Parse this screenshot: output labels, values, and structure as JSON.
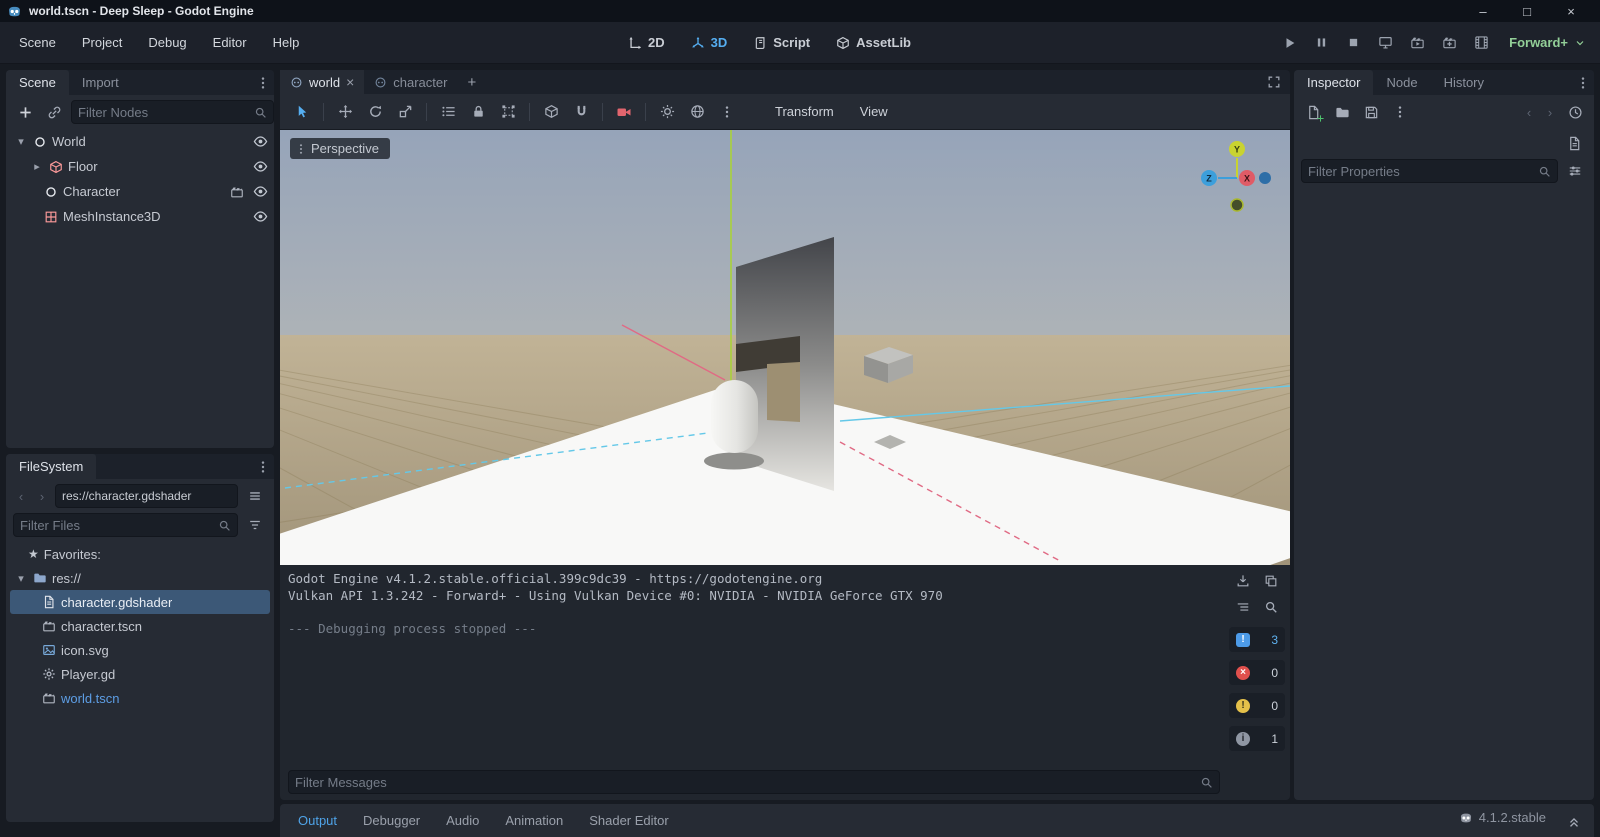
{
  "window": {
    "title": "world.tscn - Deep Sleep - Godot Engine"
  },
  "glyphs": {
    "minimize": "–",
    "maximize": "□",
    "close": "×",
    "plus": "+",
    "star": "★",
    "caret_down": "▾",
    "caret_right": "▸",
    "chevron_left": "‹",
    "chevron_right": "›",
    "log_badge": "!",
    "error_badge": "×",
    "warning_badge": "!",
    "info_badge": "i"
  },
  "menubar": {
    "menus": [
      {
        "label": "Scene"
      },
      {
        "label": "Project"
      },
      {
        "label": "Debug"
      },
      {
        "label": "Editor"
      },
      {
        "label": "Help"
      }
    ],
    "context": [
      {
        "label": "2D"
      },
      {
        "label": "3D"
      },
      {
        "label": "Script"
      },
      {
        "label": "AssetLib"
      }
    ],
    "renderer": "Forward+"
  },
  "scene_dock": {
    "tabs": [
      {
        "label": "Scene"
      },
      {
        "label": "Import"
      }
    ],
    "filter_placeholder": "Filter Nodes",
    "nodes": [
      {
        "name": "World"
      },
      {
        "name": "Floor"
      },
      {
        "name": "Character"
      },
      {
        "name": "MeshInstance3D"
      }
    ]
  },
  "filesystem_dock": {
    "title": "FileSystem",
    "path": "res://character.gdshader",
    "filter_placeholder": "Filter Files",
    "items": [
      {
        "name": "Favorites:"
      },
      {
        "name": "res://"
      },
      {
        "name": "character.gdshader"
      },
      {
        "name": "character.tscn"
      },
      {
        "name": "icon.svg"
      },
      {
        "name": "Player.gd"
      },
      {
        "name": "world.tscn"
      }
    ]
  },
  "scene_tabs": {
    "tabs": [
      {
        "label": "world"
      },
      {
        "label": "character"
      }
    ]
  },
  "viewport": {
    "projection_label": "Perspective",
    "menus": [
      {
        "label": "Transform"
      },
      {
        "label": "View"
      }
    ],
    "gizmo": {
      "x": "X",
      "y": "Y",
      "z": "Z"
    }
  },
  "output": {
    "lines": [
      "Godot Engine v4.1.2.stable.official.399c9dc39 - https://godotengine.org",
      "Vulkan API 1.3.242 - Forward+ - Using Vulkan Device #0: NVIDIA - NVIDIA GeForce GTX 970",
      "",
      "--- Debugging process stopped ---"
    ],
    "filter_placeholder": "Filter Messages",
    "counts": {
      "log": "3",
      "errors": "0",
      "warnings": "0",
      "info": "1"
    }
  },
  "bottom_bar": {
    "tabs": [
      {
        "label": "Output"
      },
      {
        "label": "Debugger"
      },
      {
        "label": "Audio"
      },
      {
        "label": "Animation"
      },
      {
        "label": "Shader Editor"
      }
    ],
    "version": "4.1.2.stable"
  },
  "inspector_dock": {
    "tabs": [
      {
        "label": "Inspector"
      },
      {
        "label": "Node"
      },
      {
        "label": "History"
      }
    ],
    "filter_placeholder": "Filter Properties"
  }
}
